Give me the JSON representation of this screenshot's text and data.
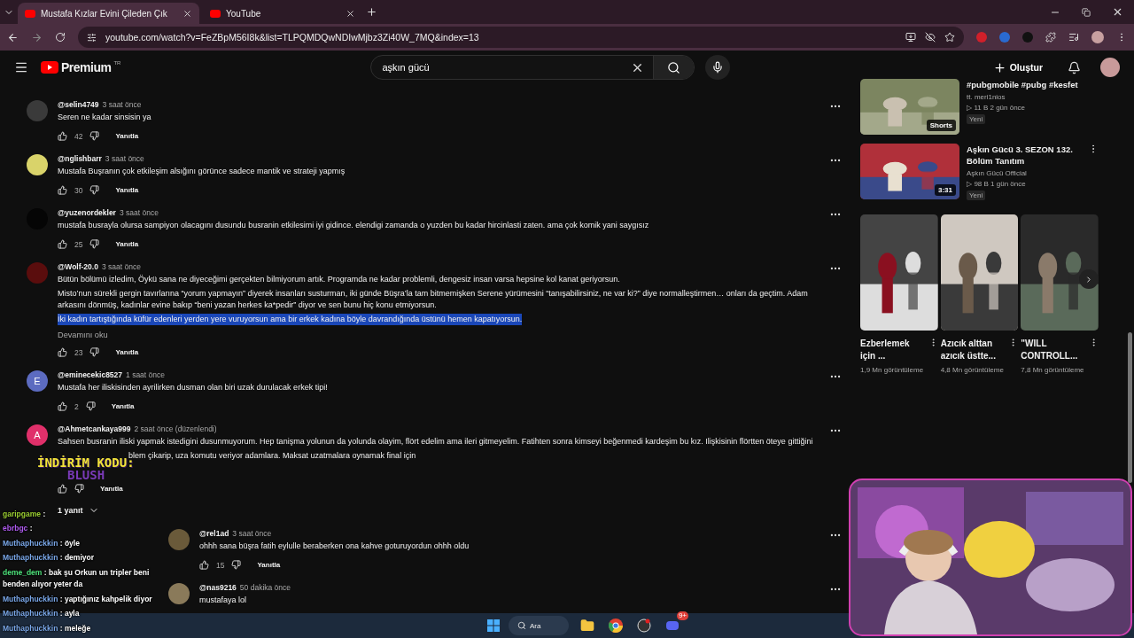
{
  "browser": {
    "tabs": [
      {
        "title": "Mustafa Kızlar Evini Çileden Çık",
        "selected": true
      },
      {
        "title": "YouTube",
        "selected": false
      }
    ],
    "url": "youtube.com/watch?v=FeZBpM56I8k&list=TLPQMDQwNDIwMjbz3Zi40W_7MQ&index=13"
  },
  "header": {
    "brand": "Premium",
    "region": "TR",
    "search": {
      "value": "aşkın gücü"
    },
    "create_label": "Oluştur"
  },
  "comments": [
    {
      "user": "@selin4749",
      "time": "3 saat önce",
      "avatar": {
        "color": "#3a3a3a"
      },
      "lines": [
        {
          "text": "Seren ne kadar sinsisin ya",
          "selected": false
        }
      ],
      "likes": "42",
      "reply_label": "Yanıtla"
    },
    {
      "user": "@nglishbarr",
      "time": "3 saat önce",
      "avatar": {
        "color": "#d9d36a"
      },
      "lines": [
        {
          "text": "Mustafa Buşranın çok etkileşim alsığını görünce sadece mantik ve strateji yapmış",
          "selected": false
        }
      ],
      "likes": "30",
      "reply_label": "Yanıtla"
    },
    {
      "user": "@yuzenordekler",
      "time": "3 saat önce",
      "avatar": {
        "color": "#050505"
      },
      "lines": [
        {
          "text": "mustafa busrayla olursa sampiyon olacagını dusundu busranin etkilesimi iyi gidince. elendigi zamanda o yuzden bu kadar hircinlasti zaten. ama çok komik yani saygısız",
          "selected": false
        }
      ],
      "likes": "25",
      "reply_label": "Yanıtla"
    },
    {
      "user": "@Wolf-20.0",
      "time": "3 saat önce",
      "avatar": {
        "color": "#5a0d0d"
      },
      "lines": [
        {
          "text": "Bütün bölümü izledim, Öykü sana ne diyeceğimi gerçekten bilmiyorum artık. Programda ne kadar problemli, dengesiz insan varsa hepsine kol kanat geriyorsun.",
          "selected": false
        },
        {
          "text": "Misto’nun sürekli gergin tavırlarına “yorum yapmayın” diyerek insanları susturman, iki günde Büşra’la tam bitmemişken Serene yürümesini “tanışabilirsiniz, ne var ki?” diye normalleştirmen… onları da geçtim. Adam arkasını dönmüş, kadınlar evine bakıp “beni yazan herkes ka*pedir” diyor ve sen bunu hiç konu etmiyorsun.",
          "selected": false
        },
        {
          "text": "İki kadın tartıştığında küfür edenleri yerden yere vuruyorsun ama bir erkek kadına böyle davrandığında üstünü hemen kapatıyorsun.",
          "selected": true
        }
      ],
      "more_label": "Devamını oku",
      "likes": "23",
      "reply_label": "Yanıtla"
    },
    {
      "user": "@eminecekic8527",
      "time": "1 saat önce",
      "avatar": {
        "letter": "E",
        "color": "#5c6bc0"
      },
      "lines": [
        {
          "text": "Mustafa her iliskisinden ayrilirken  dusman olan biri uzak durulacak erkek tipi!",
          "selected": false
        }
      ],
      "likes": "2",
      "reply_label": "Yanıtla"
    },
    {
      "user": "@Ahmetcankaya999",
      "time": "2 saat önce (düzenlendi)",
      "avatar": {
        "letter": "A",
        "color": "#e0306a"
      },
      "lines": [
        {
          "text": "Sahsen busranin iliski yapmak istedigini dusunmuyorum. Hep tanişma yolunun da yolunda olayim, flört edelim ama ileri gitmeyelim. Fatihten sonra kimseyi beğenmedi kardeşim bu kız. Ilişkisinin flörtten öteye gittiğini",
          "selected": false
        },
        {
          "text": "blem çikarip, uza komutu veriyor adamlara. Maksat uzatmalara oynamak final için",
          "selected": false
        }
      ],
      "reply_label": "Yanıtla",
      "replies_label": "1 yanıt"
    },
    {
      "user": "@rel1ad",
      "time": "3 saat önce",
      "avatar": {
        "color": "#6a5a3a"
      },
      "lines": [
        {
          "text": "ohhh sana büşra fatih eylulle beraberken ona kahve goturuyordun ohhh oldu",
          "selected": false
        }
      ],
      "likes": "15",
      "reply_label": "Yanıtla"
    },
    {
      "user": "@nas9216",
      "time": "50 dakika önce",
      "avatar": {
        "color": "#8a7a5a"
      },
      "lines": [
        {
          "text": "mustafaya lol",
          "selected": false
        }
      ]
    }
  ],
  "related": [
    {
      "title": "#pubgmobile #pubg #kesfet",
      "channel": "tt. meri1nios",
      "meta": "▷ 11 B  2 gün önce",
      "badge": "Yeni",
      "overlay": "Shorts",
      "kind": "short"
    },
    {
      "title": "Aşkın Gücü 3. SEZON 132. Bölüm Tanıtım",
      "channel": "Aşkın Gücü Official",
      "meta": "▷ 98 B  1 gün önce",
      "badge": "Yeni",
      "overlay": "3:31",
      "kind": "video"
    }
  ],
  "shorts": [
    {
      "title": "Ezberlemek için ...",
      "views": "1,9 Mn görüntüleme"
    },
    {
      "title": "Azıcık alttan azıcık üstte...",
      "views": "4,8 Mn görüntüleme"
    },
    {
      "title": "\"WILL CONTROLL...",
      "views": "7,8 Mn görüntüleme"
    }
  ],
  "promo": {
    "line1": "İNDİRİM KODU:",
    "line2": "BLUSH"
  },
  "chat": [
    {
      "user": "garipgame",
      "text": ":",
      "color": "#9acd32"
    },
    {
      "user": "ebrbgc",
      "text": ":",
      "color": "#b05cf0"
    },
    {
      "user": "Muthaphuckkin",
      "text": ": öyle",
      "color": "#7aa7e8"
    },
    {
      "user": "Muthaphuckkin",
      "text": ": demiyor",
      "color": "#7aa7e8"
    },
    {
      "user": "deme_dem",
      "text": ": bak şu Orkun un tripler beni benden alıyor yeter da",
      "color": "#4ee07a"
    },
    {
      "user": "Muthaphuckkin",
      "text": ": yaptığınız kahpelik diyor",
      "color": "#7aa7e8"
    },
    {
      "user": "Muthaphuckkin",
      "text": ": ayla",
      "color": "#7aa7e8"
    },
    {
      "user": "Muthaphuckkin",
      "text": ": meleğe",
      "color": "#7aa7e8"
    }
  ],
  "taskbar": {
    "search_label": "Ara",
    "discord_badge": "9+"
  }
}
